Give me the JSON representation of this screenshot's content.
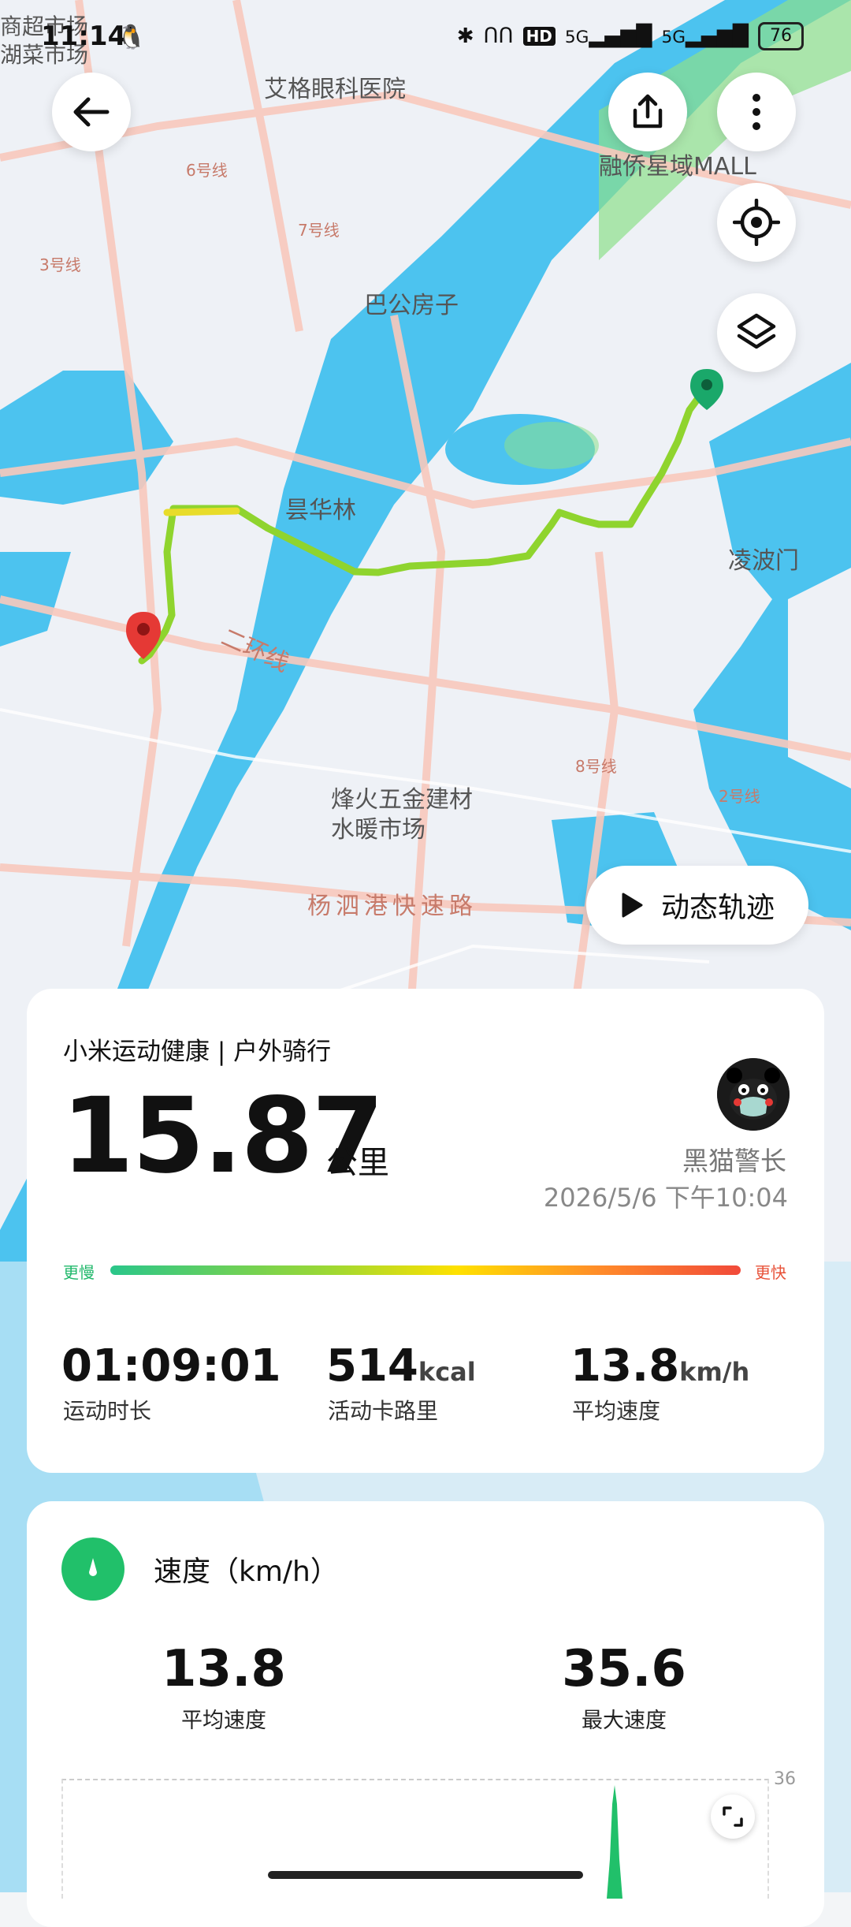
{
  "status_bar": {
    "time": "11:14",
    "network_1": "5G",
    "network_2": "5G",
    "hd_label": "HD",
    "battery": "76"
  },
  "map": {
    "labels": {
      "hospital": "艾格眼科医院",
      "mall": "融侨星域MALL",
      "house": "巴公房子",
      "area1": "昙华林",
      "gate": "凌波门",
      "market": "烽火五金建材水暖市场",
      "expressway": "杨泗港快速路",
      "ring_road": "二环线",
      "corner_market": "商超市场",
      "corner_market2": "湖菜市场",
      "line6": "6号线",
      "line7": "7号线",
      "line3": "3号线",
      "line8": "8号线",
      "line2": "2号线"
    },
    "dynamic_track_label": "动态轨迹"
  },
  "summary": {
    "brand": "小米运动健康 | 户外骑行",
    "distance": "15.87",
    "distance_unit": "公里",
    "user_name": "黑猫警长",
    "datetime": "2026/5/6 下午10:04",
    "slow_label": "更慢",
    "fast_label": "更快",
    "stats": [
      {
        "value": "01:09:01",
        "unit": "",
        "label": "运动时长"
      },
      {
        "value": "514",
        "unit": "kcal",
        "label": "活动卡路里"
      },
      {
        "value": "13.8",
        "unit": "km/h",
        "label": "平均速度"
      }
    ]
  },
  "speed_section": {
    "title": "速度（km/h）",
    "avg_value": "13.8",
    "avg_label": "平均速度",
    "max_value": "35.6",
    "max_label": "最大速度",
    "chart_ymax": "36"
  },
  "colors": {
    "route_start": "#1aa86a",
    "route_end": "#e53935",
    "speed_green": "#21c06a",
    "water": "#4cc3ef",
    "land": "#eef1f6"
  }
}
